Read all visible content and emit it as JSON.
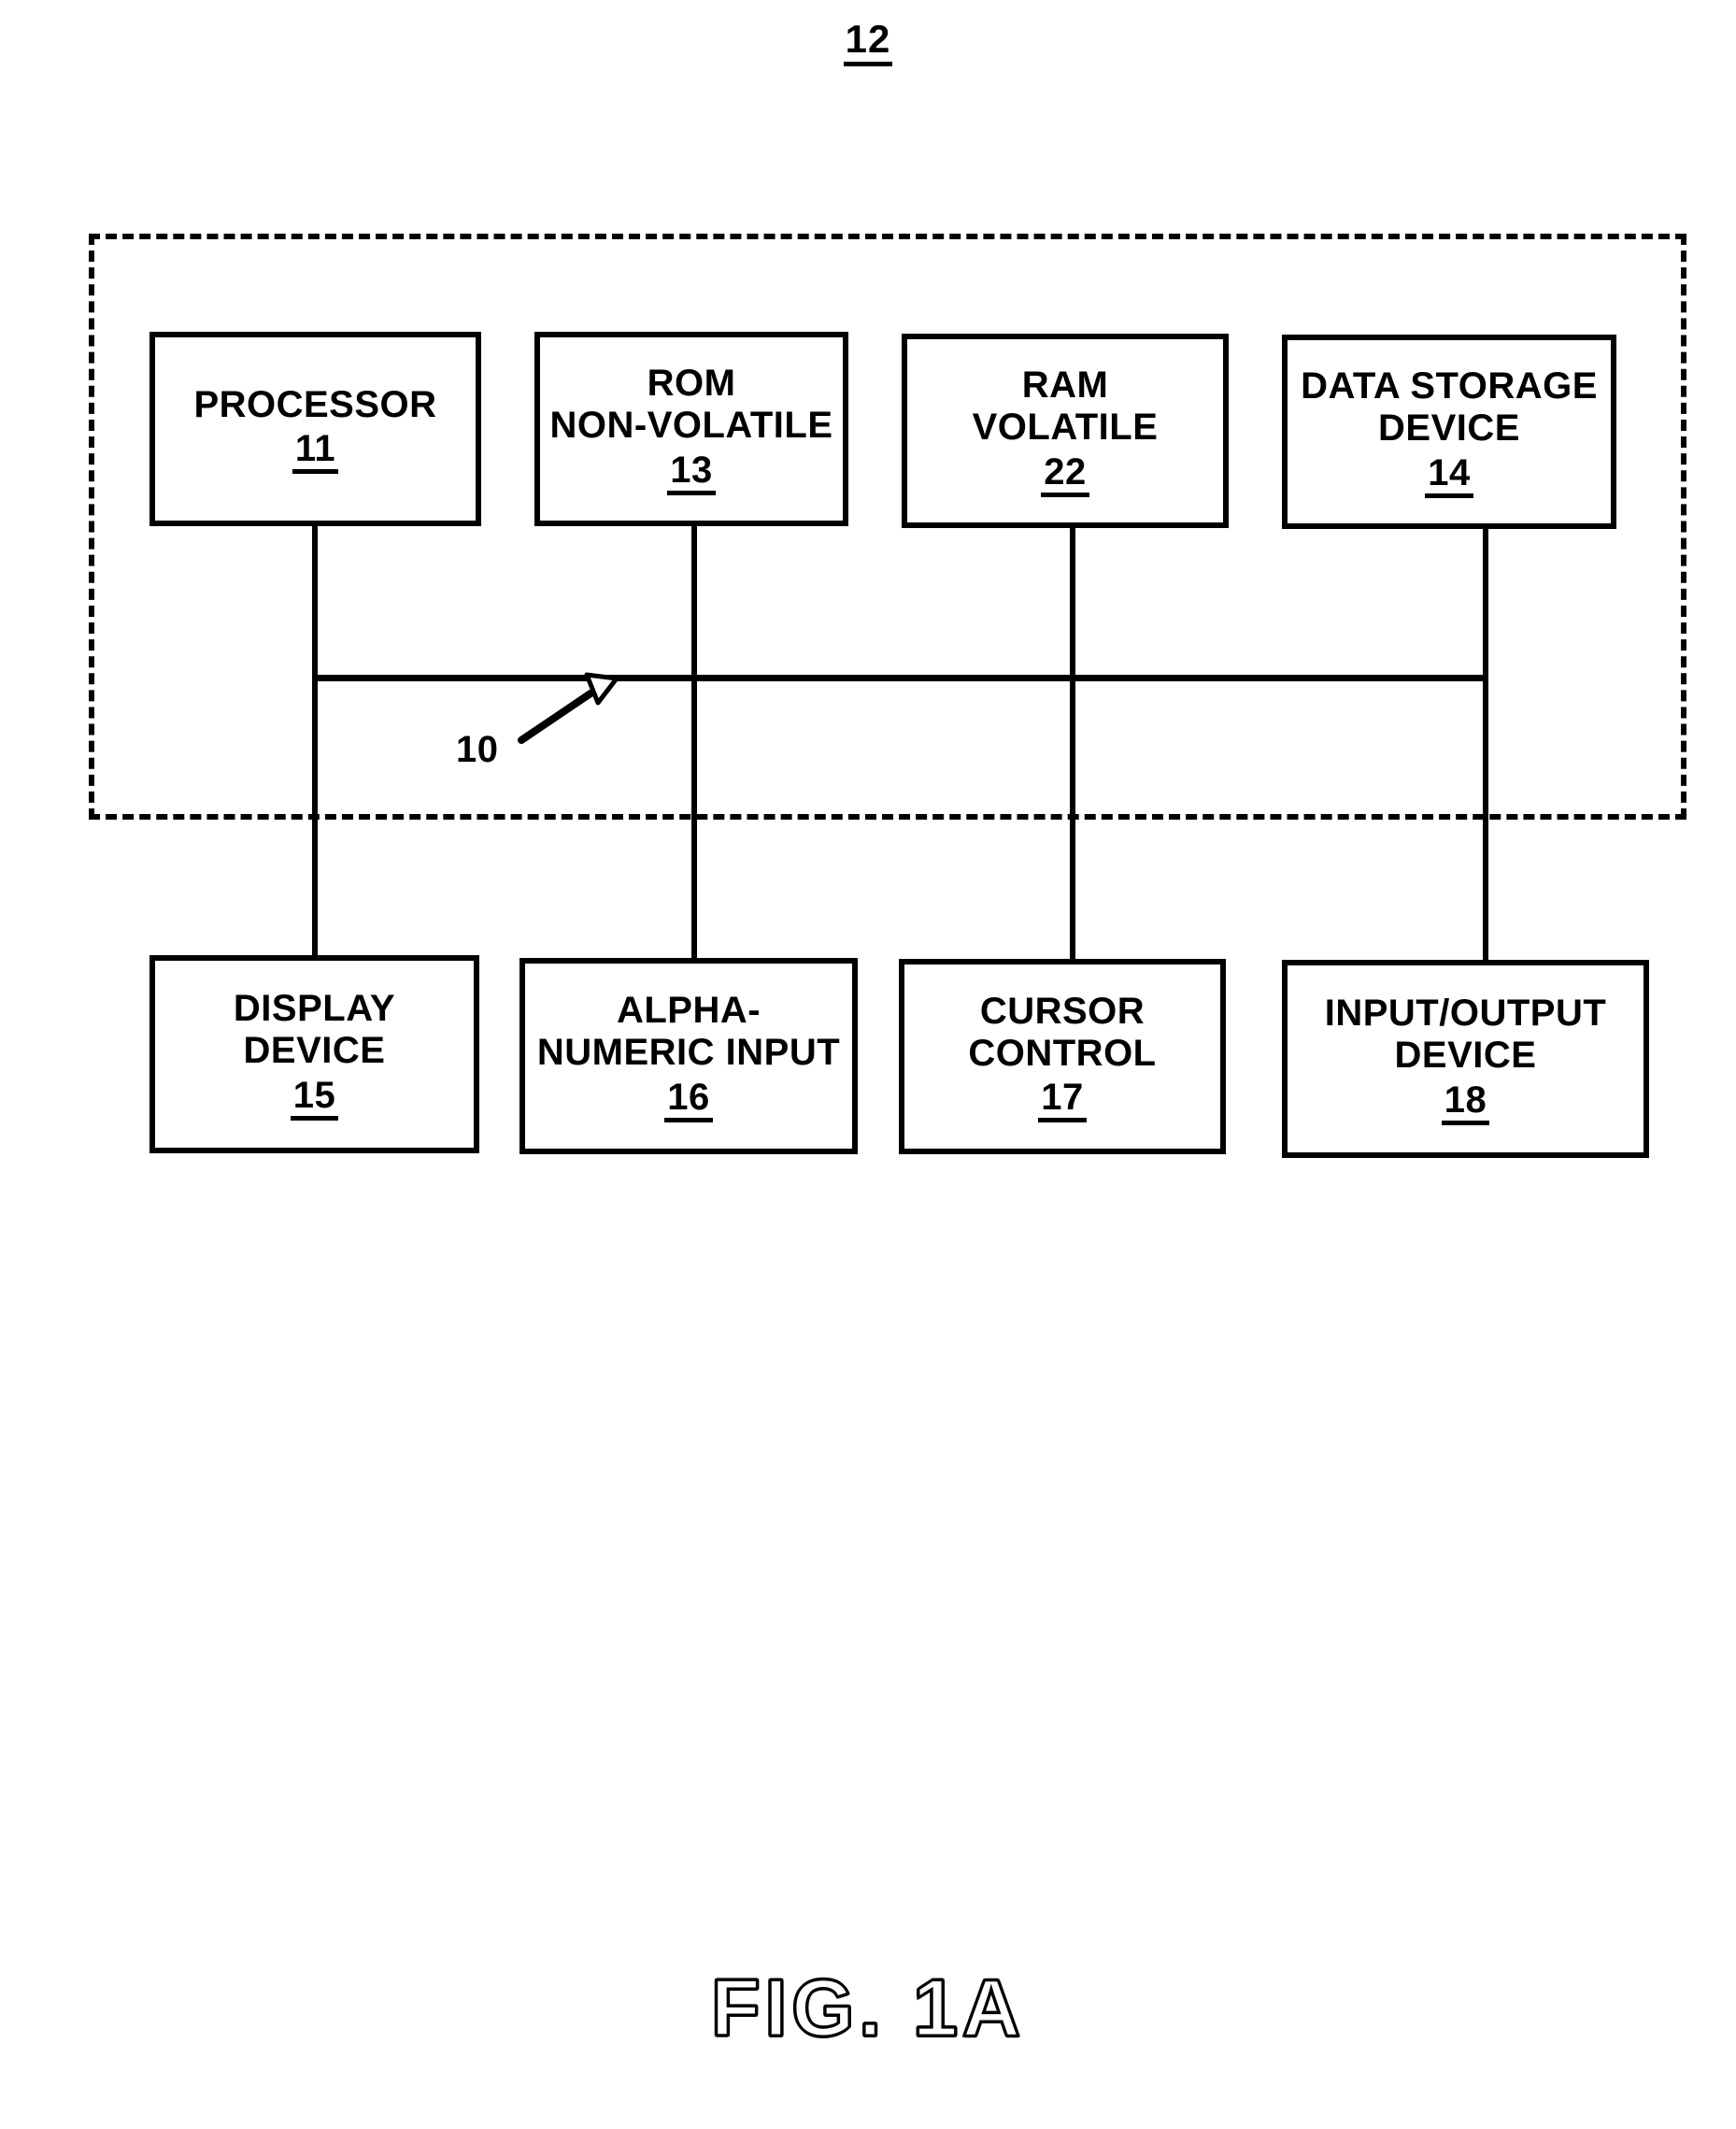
{
  "figure": {
    "caption": "FIG. 1A",
    "system_reference_numeral": "12",
    "bus_reference_numeral": "10"
  },
  "blocks": {
    "top_row": [
      {
        "label": "PROCESSOR",
        "number": "11",
        "name": "processor"
      },
      {
        "label": "ROM\nNON-VOLATILE",
        "number": "13",
        "name": "rom-non-volatile"
      },
      {
        "label": "RAM\nVOLATILE",
        "number": "22",
        "name": "ram-volatile"
      },
      {
        "label": "DATA STORAGE\nDEVICE",
        "number": "14",
        "name": "data-storage-device"
      }
    ],
    "bottom_row": [
      {
        "label": "DISPLAY\nDEVICE",
        "number": "15",
        "name": "display-device"
      },
      {
        "label": "ALPHA-\nNUMERIC INPUT",
        "number": "16",
        "name": "alpha-numeric-input"
      },
      {
        "label": "CURSOR\nCONTROL",
        "number": "17",
        "name": "cursor-control"
      },
      {
        "label": "INPUT/OUTPUT\nDEVICE",
        "number": "18",
        "name": "input-output-device"
      }
    ]
  },
  "colors": {
    "ink": "#000000",
    "background": "#ffffff"
  }
}
